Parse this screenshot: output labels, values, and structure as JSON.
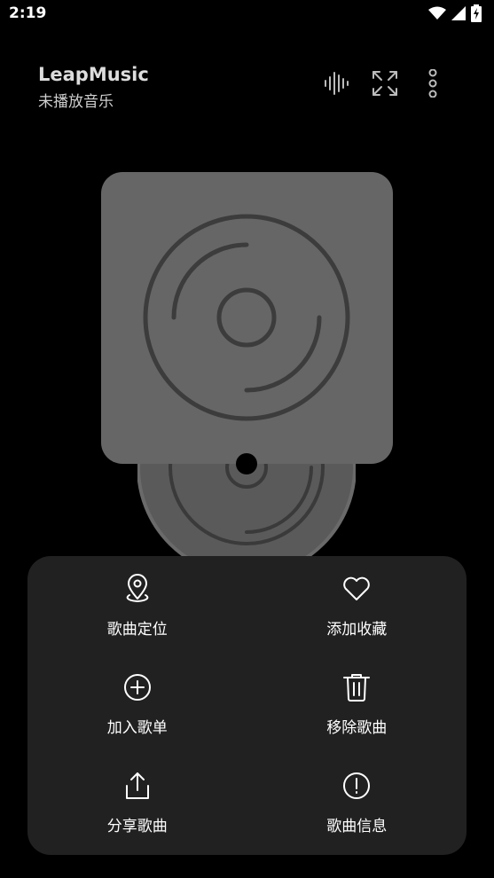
{
  "status": {
    "time": "2:19"
  },
  "header": {
    "title": "LeapMusic",
    "subtitle": "未播放音乐"
  },
  "actions": [
    {
      "label": "歌曲定位",
      "icon": "location-pin-icon"
    },
    {
      "label": "添加收藏",
      "icon": "heart-icon"
    },
    {
      "label": "加入歌单",
      "icon": "add-circle-icon"
    },
    {
      "label": "移除歌曲",
      "icon": "trash-icon"
    },
    {
      "label": "分享歌曲",
      "icon": "share-icon"
    },
    {
      "label": "歌曲信息",
      "icon": "info-icon"
    }
  ],
  "colors": {
    "background": "#000000",
    "sheet": "#212121",
    "card": "#666666",
    "disc": "#555555"
  }
}
